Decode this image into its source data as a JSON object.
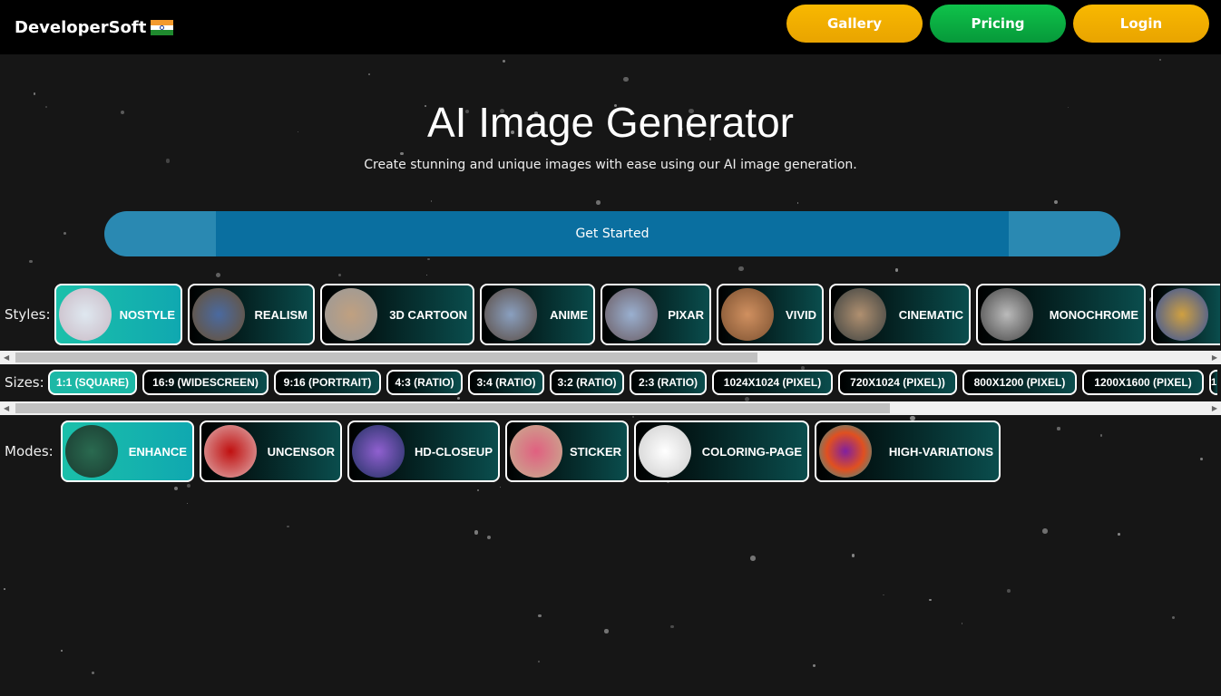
{
  "header": {
    "brand": "DeveloperSoft",
    "flag_icon": "india-flag-icon",
    "nav": [
      {
        "label": "Gallery",
        "color": "#f5b100"
      },
      {
        "label": "Pricing",
        "color": "#0bb043"
      },
      {
        "label": "Login",
        "color": "#f5b100"
      }
    ]
  },
  "hero": {
    "title": "AI Image Generator",
    "subtitle": "Create stunning and unique images with ease using our AI image generation.",
    "cta": "Get Started"
  },
  "styles": {
    "label": "Styles:",
    "selected": "NOSTYLE",
    "items": [
      "NOSTYLE",
      "REALISM",
      "3D CARTOON",
      "ANIME",
      "PIXAR",
      "VIVID",
      "CINEMATIC",
      "MONOCHROME",
      ""
    ]
  },
  "sizes": {
    "label": "Sizes:",
    "selected": "1:1 (SQUARE)",
    "items": [
      "1:1 (SQUARE)",
      "16:9 (WIDESCREEN)",
      "9:16 (PORTRAIT)",
      "4:3 (RATIO)",
      "3:4 (RATIO)",
      "3:2 (RATIO)",
      "2:3 (RATIO)",
      "1024X1024 (PIXEL)",
      "720X1024 (PIXEL))",
      "800X1200 (PIXEL)",
      "1200X1600 (PIXEL)",
      "1"
    ]
  },
  "modes": {
    "label": "Modes:",
    "selected": "ENHANCE",
    "items": [
      "ENHANCE",
      "UNCENSOR",
      "HD-CLOSEUP",
      "STICKER",
      "COLORING-PAGE",
      "HIGH-VARIATIONS"
    ]
  },
  "colors": {
    "accent": "#1db8a6",
    "cta": "#0a6fa0",
    "background": "#161616"
  }
}
